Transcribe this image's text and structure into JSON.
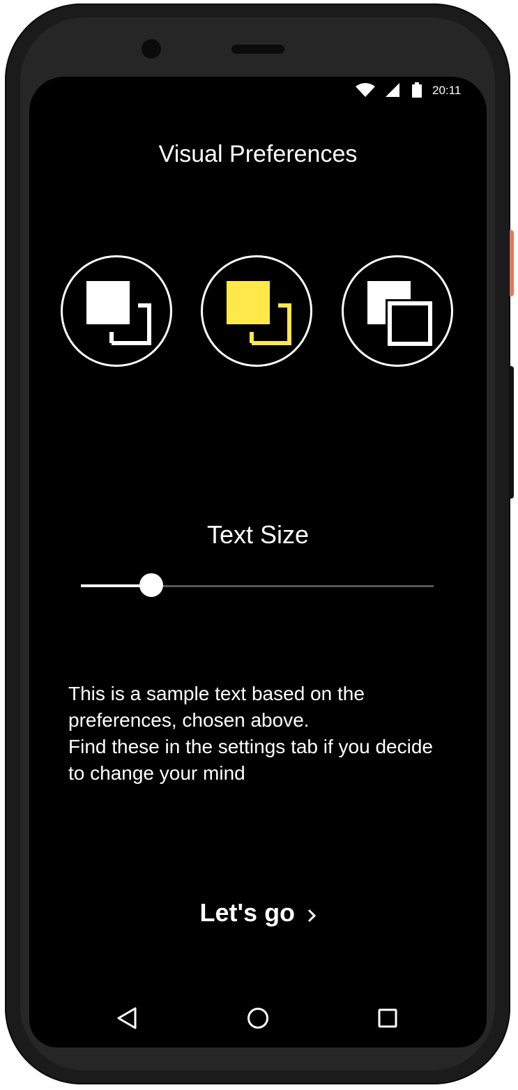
{
  "status_bar": {
    "time": "20:11",
    "icons": [
      "wifi-icon",
      "signal-icon",
      "battery-icon"
    ]
  },
  "page": {
    "title": "Visual Preferences"
  },
  "themes": {
    "options": [
      {
        "name": "white-on-black",
        "accent": "#ffffff"
      },
      {
        "name": "yellow-on-black",
        "accent": "#ffe84a"
      },
      {
        "name": "outline-contrast",
        "accent": "#ffffff"
      }
    ]
  },
  "text_size": {
    "label": "Text Size",
    "slider_value_fraction": 0.2
  },
  "sample": {
    "line1": "This is a sample text based on the preferences, chosen above.",
    "line2": "Find these in the settings tab if you decide to change your mind"
  },
  "action": {
    "label": "Let's go",
    "icon": "chevron-right-icon"
  },
  "colors": {
    "background": "#000000",
    "foreground": "#ffffff",
    "yellow": "#ffe84a"
  },
  "nav": {
    "icons": [
      "back-icon",
      "home-icon",
      "recents-icon"
    ]
  }
}
